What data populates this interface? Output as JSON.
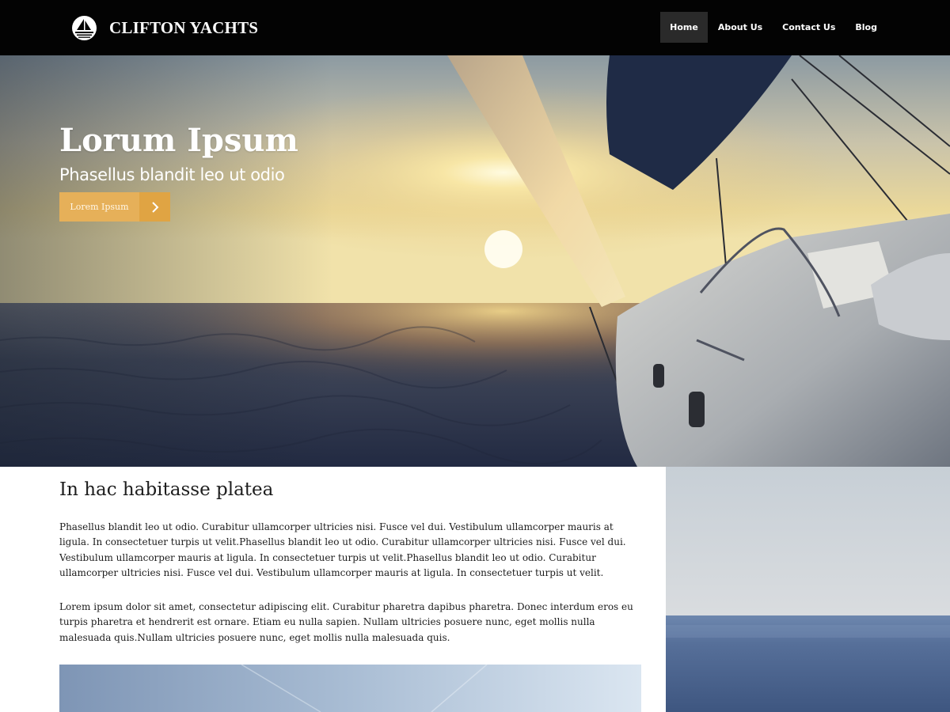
{
  "header": {
    "brand_name": "CLIFTON YACHTS",
    "nav": [
      {
        "label": "Home",
        "active": true
      },
      {
        "label": "About Us",
        "active": false
      },
      {
        "label": "Contact Us",
        "active": false
      },
      {
        "label": "Blog",
        "active": false
      }
    ]
  },
  "hero": {
    "title": "Lorum Ipsum",
    "subtitle": "Phasellus blandit leo ut odio",
    "button_label": "Lorem Ipsum",
    "button_icon": "chevron-right-icon"
  },
  "content": {
    "heading": "In hac habitasse platea",
    "paragraphs": [
      "Phasellus blandit leo ut odio. Curabitur ullamcorper ultricies nisi. Fusce vel dui. Vestibulum ullamcorper mauris at ligula. In consectetuer turpis ut velit.Phasellus blandit leo ut odio. Curabitur ullamcorper ultricies nisi. Fusce vel dui. Vestibulum ullamcorper mauris at ligula. In consectetuer turpis ut velit.Phasellus blandit leo ut odio. Curabitur ullamcorper ultricies nisi. Fusce vel dui. Vestibulum ullamcorper mauris at ligula. In consectetuer turpis ut velit.",
      "Lorem ipsum dolor sit amet, consectetur adipiscing elit. Curabitur pharetra dapibus pharetra. Donec interdum eros eu turpis pharetra et hendrerit est ornare. Etiam eu nulla sapien. Nullam ultricies posuere nunc, eget mollis nulla malesuada quis.Nullam ultricies posuere nunc, eget mollis nulla malesuada quis."
    ]
  },
  "colors": {
    "header_bg": "#030303",
    "nav_active_bg": "#2a2a2a",
    "accent": "#e6b059",
    "accent_dark": "#e0a443"
  }
}
